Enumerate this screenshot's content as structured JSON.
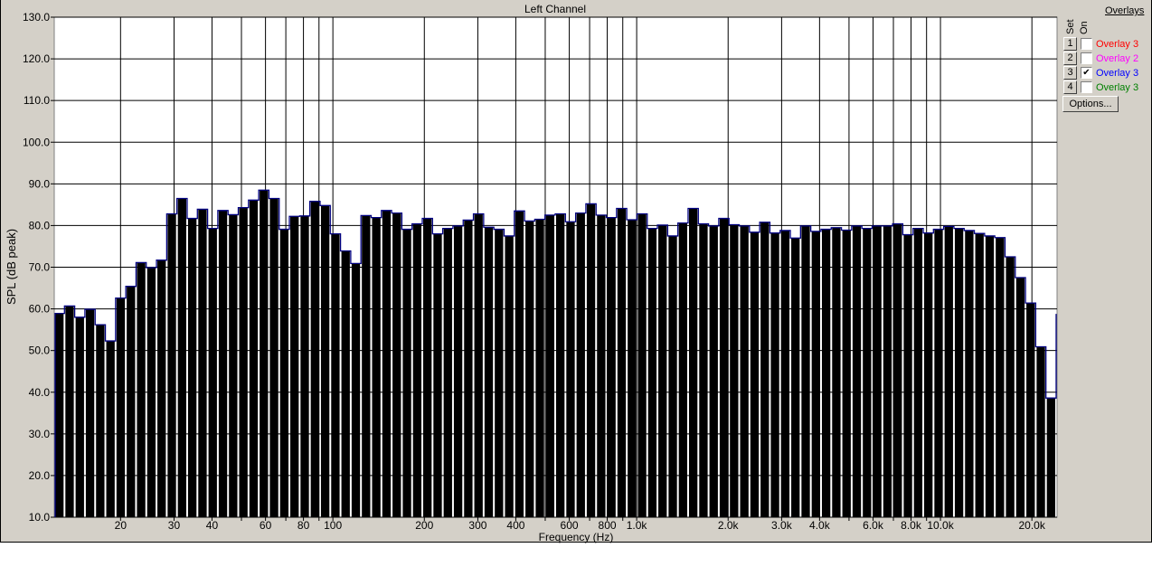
{
  "chart_data": {
    "type": "bar",
    "title": "Left Channel",
    "xlabel": "Frequency (Hz)",
    "ylabel": "SPL (dB peak)",
    "xscale": "log",
    "xlim_hz": [
      12.1,
      24200
    ],
    "ylim": [
      10,
      130
    ],
    "yticks": [
      10,
      20,
      30,
      40,
      50,
      60,
      70,
      80,
      90,
      100,
      110,
      120,
      130
    ],
    "ytick_labels": [
      "10.0",
      "20.0",
      "30.0",
      "40.0",
      "50.0",
      "60.0",
      "70.0",
      "80.0",
      "90.0",
      "100.0",
      "110.0",
      "120.0",
      "130.0"
    ],
    "xgrid_hz": [
      20,
      30,
      40,
      50,
      60,
      70,
      80,
      90,
      100,
      200,
      300,
      400,
      500,
      600,
      700,
      800,
      900,
      1000,
      2000,
      3000,
      4000,
      5000,
      6000,
      7000,
      8000,
      9000,
      10000,
      20000
    ],
    "xticks": [
      {
        "hz": 20,
        "label": "20"
      },
      {
        "hz": 30,
        "label": "30"
      },
      {
        "hz": 40,
        "label": "40"
      },
      {
        "hz": 60,
        "label": "60"
      },
      {
        "hz": 80,
        "label": "80"
      },
      {
        "hz": 100,
        "label": "100"
      },
      {
        "hz": 200,
        "label": "200"
      },
      {
        "hz": 300,
        "label": "300"
      },
      {
        "hz": 400,
        "label": "400"
      },
      {
        "hz": 600,
        "label": "600"
      },
      {
        "hz": 800,
        "label": "800"
      },
      {
        "hz": 1000,
        "label": "1.0k"
      },
      {
        "hz": 2000,
        "label": "2.0k"
      },
      {
        "hz": 3000,
        "label": "3.0k"
      },
      {
        "hz": 4000,
        "label": "4.0k"
      },
      {
        "hz": 6000,
        "label": "6.0k"
      },
      {
        "hz": 8000,
        "label": "8.0k"
      },
      {
        "hz": 10000,
        "label": "10.0k"
      },
      {
        "hz": 20000,
        "label": "20.0k"
      }
    ],
    "grid": true,
    "bar_color": "#000000",
    "outline_color": "#000080",
    "values": [
      58.9,
      60.7,
      58.0,
      59.9,
      56.2,
      52.3,
      62.6,
      65.4,
      71.1,
      69.9,
      71.7,
      82.8,
      86.5,
      81.7,
      83.9,
      79.3,
      83.6,
      82.6,
      84.3,
      86.1,
      88.5,
      86.5,
      79.1,
      82.2,
      82.3,
      85.8,
      84.8,
      78.0,
      73.9,
      70.9,
      82.4,
      81.9,
      83.6,
      83.0,
      79.1,
      80.4,
      81.7,
      78.0,
      79.3,
      79.9,
      81.3,
      82.8,
      79.6,
      79.1,
      77.5,
      83.5,
      81.1,
      81.5,
      82.5,
      82.8,
      80.9,
      83.0,
      85.2,
      82.5,
      81.9,
      84.1,
      81.4,
      82.8,
      79.3,
      80.1,
      77.5,
      80.6,
      84.1,
      80.4,
      79.9,
      81.7,
      80.2,
      79.9,
      78.4,
      80.8,
      78.2,
      78.8,
      77.0,
      79.9,
      78.6,
      79.1,
      79.5,
      78.9,
      79.9,
      79.3,
      79.9,
      79.9,
      80.4,
      77.8,
      79.3,
      78.2,
      79.1,
      79.8,
      79.3,
      78.8,
      78.1,
      77.5,
      77.1,
      72.5,
      67.5,
      61.4,
      50.9,
      38.6
    ],
    "edge_value": 58.8
  },
  "overlays": {
    "title": "Overlays",
    "set_label": "Set",
    "on_label": "On",
    "options_label": "Options...",
    "items": [
      {
        "set": "1",
        "label": "Overlay 3",
        "checked": false,
        "color": "#ff0000"
      },
      {
        "set": "2",
        "label": "Overlay 2",
        "checked": false,
        "color": "#ff00ff"
      },
      {
        "set": "3",
        "label": "Overlay 3",
        "checked": true,
        "color": "#0000ff"
      },
      {
        "set": "4",
        "label": "Overlay 3",
        "checked": false,
        "color": "#008000"
      }
    ],
    "check_mark": "✔"
  }
}
